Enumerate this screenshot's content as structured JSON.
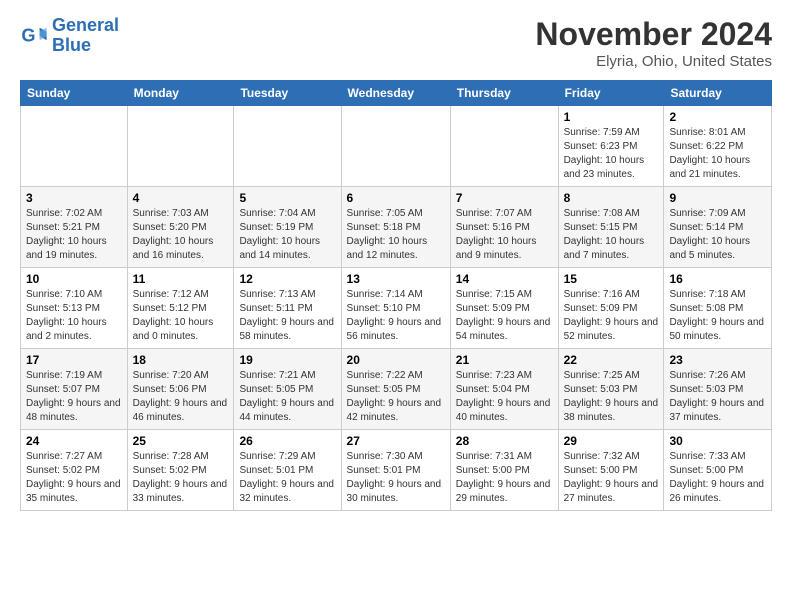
{
  "logo": {
    "line1": "General",
    "line2": "Blue"
  },
  "title": "November 2024",
  "location": "Elyria, Ohio, United States",
  "weekdays": [
    "Sunday",
    "Monday",
    "Tuesday",
    "Wednesday",
    "Thursday",
    "Friday",
    "Saturday"
  ],
  "weeks": [
    [
      {
        "day": "",
        "info": ""
      },
      {
        "day": "",
        "info": ""
      },
      {
        "day": "",
        "info": ""
      },
      {
        "day": "",
        "info": ""
      },
      {
        "day": "",
        "info": ""
      },
      {
        "day": "1",
        "info": "Sunrise: 7:59 AM\nSunset: 6:23 PM\nDaylight: 10 hours\nand 23 minutes."
      },
      {
        "day": "2",
        "info": "Sunrise: 8:01 AM\nSunset: 6:22 PM\nDaylight: 10 hours\nand 21 minutes."
      }
    ],
    [
      {
        "day": "3",
        "info": "Sunrise: 7:02 AM\nSunset: 5:21 PM\nDaylight: 10 hours\nand 19 minutes."
      },
      {
        "day": "4",
        "info": "Sunrise: 7:03 AM\nSunset: 5:20 PM\nDaylight: 10 hours\nand 16 minutes."
      },
      {
        "day": "5",
        "info": "Sunrise: 7:04 AM\nSunset: 5:19 PM\nDaylight: 10 hours\nand 14 minutes."
      },
      {
        "day": "6",
        "info": "Sunrise: 7:05 AM\nSunset: 5:18 PM\nDaylight: 10 hours\nand 12 minutes."
      },
      {
        "day": "7",
        "info": "Sunrise: 7:07 AM\nSunset: 5:16 PM\nDaylight: 10 hours\nand 9 minutes."
      },
      {
        "day": "8",
        "info": "Sunrise: 7:08 AM\nSunset: 5:15 PM\nDaylight: 10 hours\nand 7 minutes."
      },
      {
        "day": "9",
        "info": "Sunrise: 7:09 AM\nSunset: 5:14 PM\nDaylight: 10 hours\nand 5 minutes."
      }
    ],
    [
      {
        "day": "10",
        "info": "Sunrise: 7:10 AM\nSunset: 5:13 PM\nDaylight: 10 hours\nand 2 minutes."
      },
      {
        "day": "11",
        "info": "Sunrise: 7:12 AM\nSunset: 5:12 PM\nDaylight: 10 hours\nand 0 minutes."
      },
      {
        "day": "12",
        "info": "Sunrise: 7:13 AM\nSunset: 5:11 PM\nDaylight: 9 hours\nand 58 minutes."
      },
      {
        "day": "13",
        "info": "Sunrise: 7:14 AM\nSunset: 5:10 PM\nDaylight: 9 hours\nand 56 minutes."
      },
      {
        "day": "14",
        "info": "Sunrise: 7:15 AM\nSunset: 5:09 PM\nDaylight: 9 hours\nand 54 minutes."
      },
      {
        "day": "15",
        "info": "Sunrise: 7:16 AM\nSunset: 5:09 PM\nDaylight: 9 hours\nand 52 minutes."
      },
      {
        "day": "16",
        "info": "Sunrise: 7:18 AM\nSunset: 5:08 PM\nDaylight: 9 hours\nand 50 minutes."
      }
    ],
    [
      {
        "day": "17",
        "info": "Sunrise: 7:19 AM\nSunset: 5:07 PM\nDaylight: 9 hours\nand 48 minutes."
      },
      {
        "day": "18",
        "info": "Sunrise: 7:20 AM\nSunset: 5:06 PM\nDaylight: 9 hours\nand 46 minutes."
      },
      {
        "day": "19",
        "info": "Sunrise: 7:21 AM\nSunset: 5:05 PM\nDaylight: 9 hours\nand 44 minutes."
      },
      {
        "day": "20",
        "info": "Sunrise: 7:22 AM\nSunset: 5:05 PM\nDaylight: 9 hours\nand 42 minutes."
      },
      {
        "day": "21",
        "info": "Sunrise: 7:23 AM\nSunset: 5:04 PM\nDaylight: 9 hours\nand 40 minutes."
      },
      {
        "day": "22",
        "info": "Sunrise: 7:25 AM\nSunset: 5:03 PM\nDaylight: 9 hours\nand 38 minutes."
      },
      {
        "day": "23",
        "info": "Sunrise: 7:26 AM\nSunset: 5:03 PM\nDaylight: 9 hours\nand 37 minutes."
      }
    ],
    [
      {
        "day": "24",
        "info": "Sunrise: 7:27 AM\nSunset: 5:02 PM\nDaylight: 9 hours\nand 35 minutes."
      },
      {
        "day": "25",
        "info": "Sunrise: 7:28 AM\nSunset: 5:02 PM\nDaylight: 9 hours\nand 33 minutes."
      },
      {
        "day": "26",
        "info": "Sunrise: 7:29 AM\nSunset: 5:01 PM\nDaylight: 9 hours\nand 32 minutes."
      },
      {
        "day": "27",
        "info": "Sunrise: 7:30 AM\nSunset: 5:01 PM\nDaylight: 9 hours\nand 30 minutes."
      },
      {
        "day": "28",
        "info": "Sunrise: 7:31 AM\nSunset: 5:00 PM\nDaylight: 9 hours\nand 29 minutes."
      },
      {
        "day": "29",
        "info": "Sunrise: 7:32 AM\nSunset: 5:00 PM\nDaylight: 9 hours\nand 27 minutes."
      },
      {
        "day": "30",
        "info": "Sunrise: 7:33 AM\nSunset: 5:00 PM\nDaylight: 9 hours\nand 26 minutes."
      }
    ]
  ]
}
